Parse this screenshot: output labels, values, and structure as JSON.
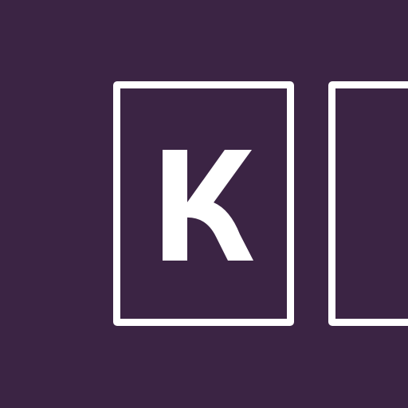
{
  "logo": {
    "letter": "K",
    "name": "k-logo-icon"
  },
  "colors": {
    "background": "#3b2444",
    "foreground": "#ffffff"
  }
}
